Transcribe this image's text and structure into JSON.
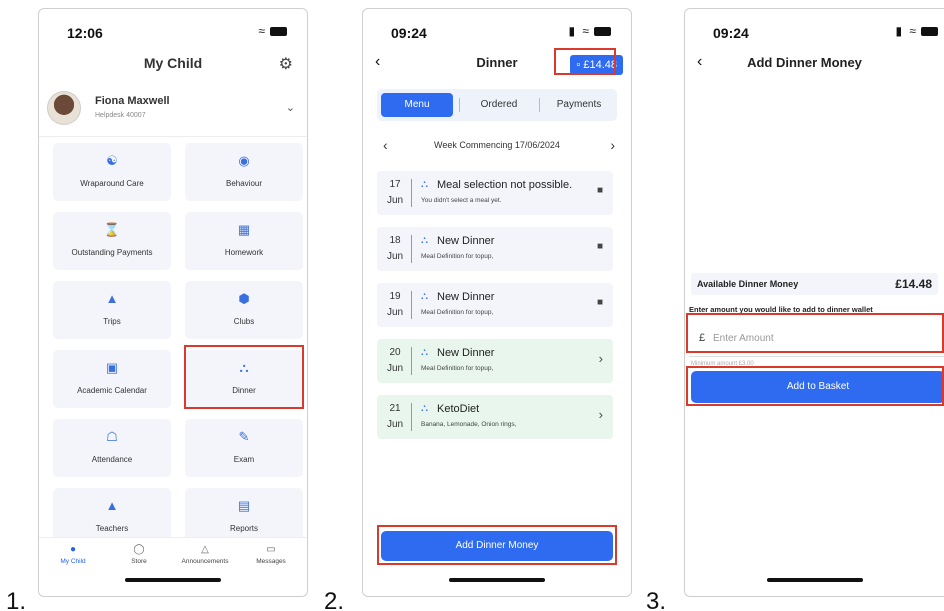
{
  "steps": [
    "1.",
    "2.",
    "3."
  ],
  "colors": {
    "accent": "#2f6bf0",
    "highlight": "#d93a2b",
    "tile_bg": "#f3f5fa",
    "green_bg": "#e8f6ee"
  },
  "phone1": {
    "time": "12:06",
    "title": "My Child",
    "child_name": "Fiona Maxwell",
    "child_sub": "Helpdesk 40007",
    "tiles": [
      {
        "label": "Wraparound Care",
        "icon": "wraparound-care-icon"
      },
      {
        "label": "Behaviour",
        "icon": "eye-icon"
      },
      {
        "label": "Outstanding Payments",
        "icon": "hourglass-icon"
      },
      {
        "label": "Homework",
        "icon": "book-icon"
      },
      {
        "label": "Trips",
        "icon": "trips-icon"
      },
      {
        "label": "Clubs",
        "icon": "cube-icon"
      },
      {
        "label": "Academic Calendar",
        "icon": "calendar-icon"
      },
      {
        "label": "Dinner",
        "icon": "cutlery-icon"
      },
      {
        "label": "Attendance",
        "icon": "attendance-icon"
      },
      {
        "label": "Exam",
        "icon": "exam-icon"
      },
      {
        "label": "Teachers",
        "icon": "mortarboard-icon"
      },
      {
        "label": "Reports",
        "icon": "report-icon"
      }
    ],
    "tabs": [
      {
        "label": "My Child",
        "icon": "person-icon"
      },
      {
        "label": "Store",
        "icon": "bag-icon"
      },
      {
        "label": "Announcements",
        "icon": "bell-icon"
      },
      {
        "label": "Messages",
        "icon": "chat-icon"
      }
    ]
  },
  "phone2": {
    "time": "09:24",
    "title": "Dinner",
    "balance": "£14.48",
    "segments": [
      "Menu",
      "Ordered",
      "Payments"
    ],
    "week_label": "Week Commencing  17/06/2024",
    "meals": [
      {
        "day": "17",
        "month": "Jun",
        "name": "Meal selection not possible.",
        "sub": "You didn't select a meal yet.",
        "status": "locked"
      },
      {
        "day": "18",
        "month": "Jun",
        "name": "New Dinner",
        "sub": "Meal Definition for topup,",
        "status": "locked"
      },
      {
        "day": "19",
        "month": "Jun",
        "name": "New Dinner",
        "sub": "Meal Definition for topup,",
        "status": "locked"
      },
      {
        "day": "20",
        "month": "Jun",
        "name": "New Dinner",
        "sub": "Meal Definition for topup,",
        "status": "open"
      },
      {
        "day": "21",
        "month": "Jun",
        "name": "KetoDiet",
        "sub": "Banana, Lemonade, Onion rings,",
        "status": "open"
      }
    ],
    "add_money_button": "Add Dinner Money"
  },
  "phone3": {
    "time": "09:24",
    "title": "Add Dinner Money",
    "available_label": "Available Dinner Money",
    "available_value": "£14.48",
    "amount_label": "Enter amount you would like to add to dinner wallet",
    "currency": "£",
    "amount_placeholder": "Enter Amount",
    "amount_value": "",
    "minimum_text": "Minimum amount £3.00",
    "basket_button": "Add to Basket"
  }
}
